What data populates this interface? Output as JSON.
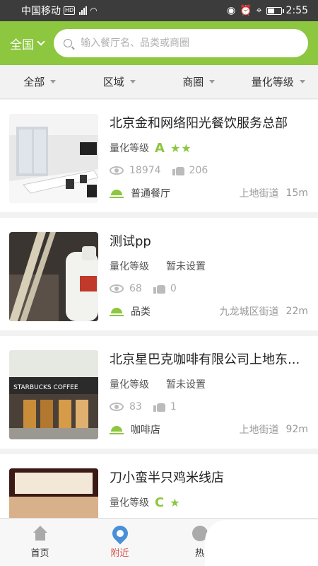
{
  "status_bar": {
    "carrier": "中国移动",
    "hd": "HD",
    "network": "4G",
    "time": "2:55",
    "battery_level": 0.5
  },
  "header": {
    "region": "全国",
    "search_placeholder": "输入餐厅名、品类或商圈"
  },
  "filters": [
    "全部",
    "区域",
    "商圈",
    "量化等级"
  ],
  "items": [
    {
      "name": "北京金和网络阳光餐饮服务总部",
      "level_label": "量化等级",
      "grade": "A",
      "stars": "★★",
      "level_value": "",
      "views": "18974",
      "likes": "206",
      "category": "普通餐厅",
      "street": "上地街道",
      "distance": "15m",
      "thumb": "office"
    },
    {
      "name": "测试pp",
      "level_label": "量化等级",
      "grade": "",
      "stars": "",
      "level_value": "暂未设置",
      "views": "68",
      "likes": "0",
      "category": "品类",
      "street": "九龙城区街道",
      "distance": "22m",
      "thumb": "bottle"
    },
    {
      "name": "北京星巴克咖啡有限公司上地东...",
      "level_label": "量化等级",
      "grade": "",
      "stars": "",
      "level_value": "暂未设置",
      "views": "83",
      "likes": "1",
      "category": "咖啡店",
      "street": "上地街道",
      "distance": "92m",
      "thumb": "starbucks"
    },
    {
      "name": "刀小蛮半只鸡米线店",
      "level_label": "量化等级",
      "grade": "C",
      "stars": "★",
      "level_value": "",
      "views": "",
      "likes": "",
      "category": "",
      "street": "",
      "distance": "",
      "thumb": "shop"
    }
  ],
  "thumb_text": {
    "starbucks": "STARBUCKS COFFEE"
  },
  "tabbar": [
    {
      "label": "首页",
      "icon": "home-icon",
      "active": false
    },
    {
      "label": "附近",
      "icon": "location-pin-icon",
      "active": true
    },
    {
      "label": "热",
      "icon": "hot-icon",
      "active": false
    }
  ],
  "colors": {
    "accent": "#8dc63f",
    "active_tab": "#d9534f",
    "pin": "#4a90d9"
  }
}
